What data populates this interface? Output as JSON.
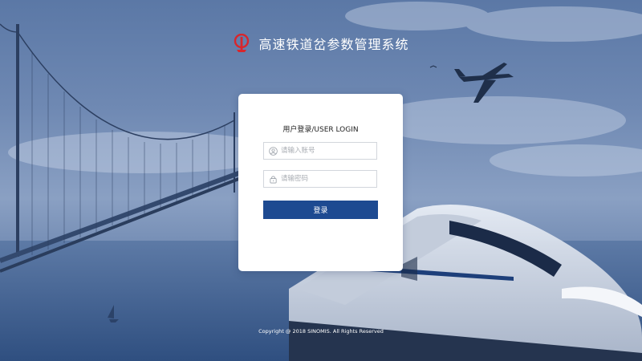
{
  "header": {
    "title": "高速铁道岔参数管理系统",
    "logo_icon": "railway-logo-icon"
  },
  "login": {
    "title": "用户登录/USER LOGIN",
    "username_placeholder": "请输入账号",
    "username_icon": "user-icon",
    "password_placeholder": "请输密码",
    "password_icon": "lock-icon",
    "submit_label": "登录"
  },
  "footer": {
    "copyright": "Copyright @ 2018 SINOMIS. All Rights Reserved"
  },
  "colors": {
    "accent": "#1d4a91",
    "logo_red": "#d8262c",
    "card_bg": "#ffffff"
  }
}
